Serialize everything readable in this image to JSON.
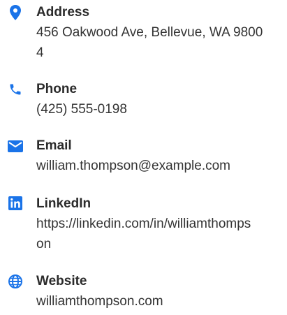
{
  "accent_color": "#1a73e8",
  "contact": {
    "items": [
      {
        "icon": "location-pin-icon",
        "label": "Address",
        "value": "456 Oakwood Ave, Bellevue, WA 98004"
      },
      {
        "icon": "phone-icon",
        "label": "Phone",
        "value": "(425) 555-0198"
      },
      {
        "icon": "envelope-icon",
        "label": "Email",
        "value": "william.thompson@example.com"
      },
      {
        "icon": "linkedin-icon",
        "label": "LinkedIn",
        "value": "https://linkedin.com/in/williamthompson"
      },
      {
        "icon": "globe-icon",
        "label": "Website",
        "value": "williamthompson.com"
      }
    ]
  }
}
